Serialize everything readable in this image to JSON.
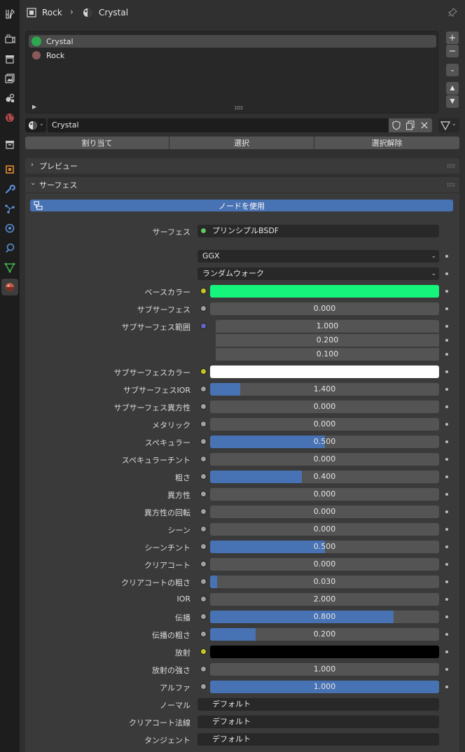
{
  "header": {
    "object_name": "Rock",
    "material_name": "Crystal"
  },
  "slots": [
    {
      "label": "Crystal",
      "icon_color": "#2ea84e",
      "active": true
    },
    {
      "label": "Rock",
      "icon_color": "#8a5a5a",
      "active": false
    }
  ],
  "material": {
    "name": "Crystal"
  },
  "assign_buttons": {
    "assign": "割り当て",
    "select": "選択",
    "deselect": "選択解除"
  },
  "panels": {
    "preview": "プレビュー",
    "surface": "サーフェス"
  },
  "use_nodes_label": "ノードを使用",
  "surface": {
    "label": "サーフェス",
    "shader": "プリンシプルBSDF"
  },
  "distribution": "GGX",
  "subsurface_method": "ランダムウォーク",
  "properties": [
    {
      "label": "ベースカラー",
      "socket": "yellow",
      "type": "color",
      "color": "#16f57b"
    },
    {
      "label": "サブサーフェス",
      "socket": "gray",
      "type": "slider",
      "value": "0.000",
      "fill": 0
    },
    {
      "label": "サブサーフェス範囲",
      "socket": "blue",
      "type": "vector",
      "values": [
        "1.000",
        "0.200",
        "0.100"
      ]
    },
    {
      "label": "サブサーフェスカラー",
      "socket": "yellow",
      "type": "color",
      "color": "#ffffff"
    },
    {
      "label": "サブサーフェスIOR",
      "socket": "gray",
      "type": "slider",
      "value": "1.400",
      "fill": 0.133
    },
    {
      "label": "サブサーフェス異方性",
      "socket": "gray",
      "type": "slider",
      "value": "0.000",
      "fill": 0
    },
    {
      "label": "メタリック",
      "socket": "gray",
      "type": "slider",
      "value": "0.000",
      "fill": 0
    },
    {
      "label": "スペキュラー",
      "socket": "gray",
      "type": "slider",
      "value": "0.500",
      "fill": 0.5
    },
    {
      "label": "スペキュラーチント",
      "socket": "gray",
      "type": "slider",
      "value": "0.000",
      "fill": 0
    },
    {
      "label": "粗さ",
      "socket": "gray",
      "type": "slider",
      "value": "0.400",
      "fill": 0.4
    },
    {
      "label": "異方性",
      "socket": "gray",
      "type": "slider",
      "value": "0.000",
      "fill": 0
    },
    {
      "label": "異方性の回転",
      "socket": "gray",
      "type": "slider",
      "value": "0.000",
      "fill": 0
    },
    {
      "label": "シーン",
      "socket": "gray",
      "type": "slider",
      "value": "0.000",
      "fill": 0
    },
    {
      "label": "シーンチント",
      "socket": "gray",
      "type": "slider",
      "value": "0.500",
      "fill": 0.5
    },
    {
      "label": "クリアコート",
      "socket": "gray",
      "type": "slider",
      "value": "0.000",
      "fill": 0
    },
    {
      "label": "クリアコートの粗さ",
      "socket": "gray",
      "type": "slider",
      "value": "0.030",
      "fill": 0.03
    },
    {
      "label": "IOR",
      "socket": "gray",
      "type": "slider",
      "value": "2.000",
      "fill": 0
    },
    {
      "label": "伝播",
      "socket": "gray",
      "type": "slider",
      "value": "0.800",
      "fill": 0.8
    },
    {
      "label": "伝播の粗さ",
      "socket": "gray",
      "type": "slider",
      "value": "0.200",
      "fill": 0.2
    },
    {
      "label": "放射",
      "socket": "yellow",
      "type": "color",
      "color": "#000000"
    },
    {
      "label": "放射の強さ",
      "socket": "gray",
      "type": "slider",
      "value": "1.000",
      "fill": 0
    },
    {
      "label": "アルファ",
      "socket": "gray",
      "type": "slider",
      "value": "1.000",
      "fill": 1
    },
    {
      "label": "ノーマル",
      "socket": "blue",
      "type": "link",
      "value": "デフォルト"
    },
    {
      "label": "クリアコート法線",
      "socket": "blue",
      "type": "link",
      "value": "デフォルト"
    },
    {
      "label": "タンジェント",
      "socket": "blue",
      "type": "link",
      "value": "デフォルト"
    }
  ],
  "icons": {
    "tabs": [
      "tool-icon",
      "render-icon",
      "output-icon",
      "view-layer-icon",
      "scene-icon",
      "world-icon",
      "collection-icon",
      "object-icon",
      "modifier-icon",
      "particles-icon",
      "physics-icon",
      "constraints-icon",
      "data-icon",
      "material-icon"
    ]
  },
  "colors": {
    "accent": "#4772b3",
    "background": "#303030",
    "panel": "#3a3a3a",
    "field": "#545454"
  }
}
